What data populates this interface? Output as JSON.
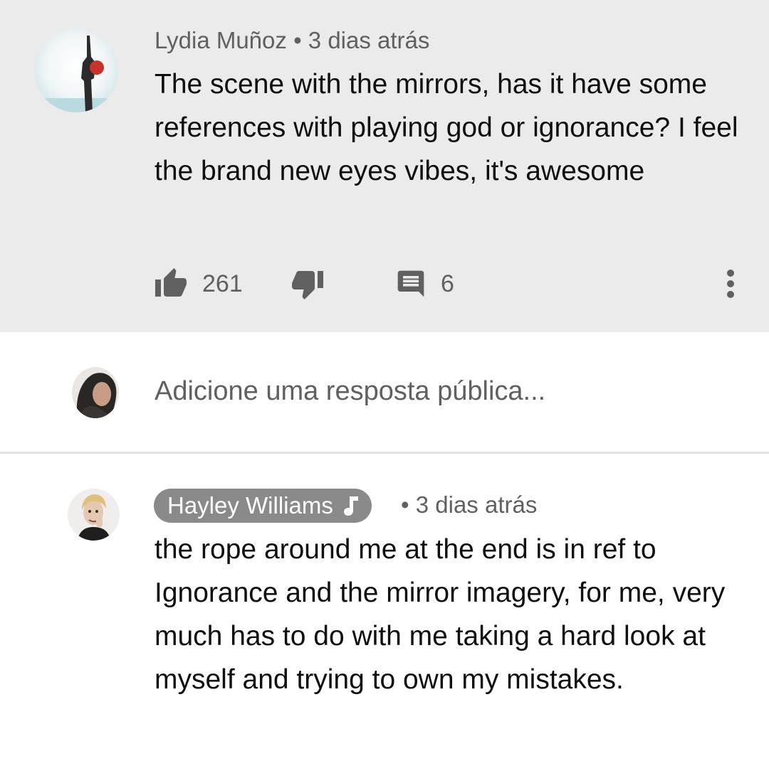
{
  "comments": [
    {
      "author": "Lydia Muñoz",
      "separator": "•",
      "time": "3 dias atrás",
      "text": "The scene with the mirrors, has it have some references with playing god or ignorance? I feel the brand new eyes vibes, it's awesome",
      "likes": "261",
      "replies": "6",
      "icons": [
        "thumbs-up-icon",
        "thumbs-down-icon",
        "reply-comment-icon",
        "more-vert-icon"
      ]
    },
    {
      "author": "Hayley Williams",
      "author_badge_icon": "music-note-icon",
      "separator": "•",
      "time": "3 dias atrás",
      "text": "the rope around me at the end is in ref to Ignorance and the mirror imagery, for me, very much has to do with me taking a hard look at myself and trying to own my mistakes."
    }
  ],
  "reply_box": {
    "placeholder": "Adicione uma resposta pública..."
  },
  "colors": {
    "highlight_bg": "#ebebeb",
    "meta_text": "#606060",
    "creator_badge_bg": "#8a8a8a",
    "divider": "#e3e3e3"
  }
}
